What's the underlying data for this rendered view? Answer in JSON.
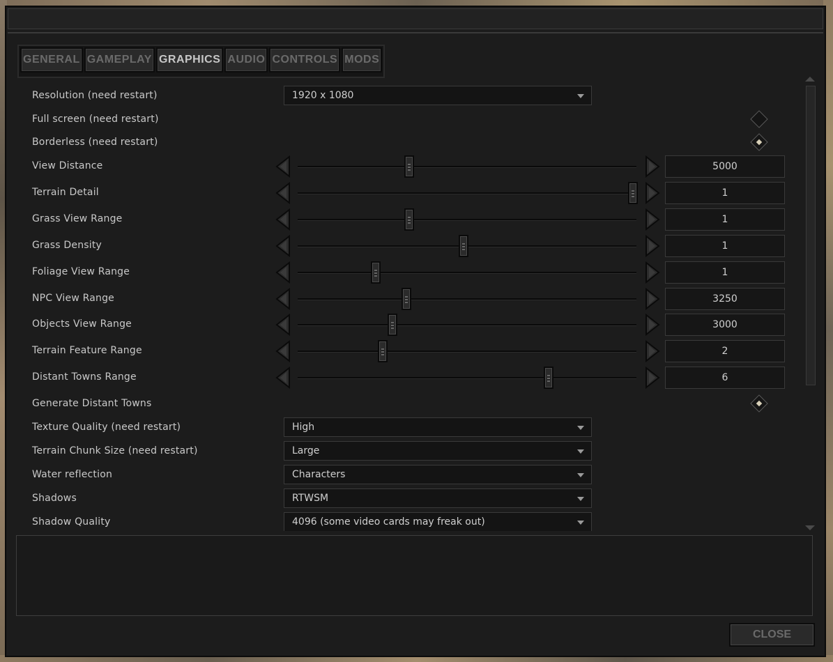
{
  "tabs": [
    {
      "label": "GENERAL",
      "active": false
    },
    {
      "label": "GAMEPLAY",
      "active": false
    },
    {
      "label": "GRAPHICS",
      "active": true
    },
    {
      "label": "AUDIO",
      "active": false
    },
    {
      "label": "CONTROLS",
      "active": false
    },
    {
      "label": "MODS",
      "active": false
    }
  ],
  "settings": {
    "resolution": {
      "label": "Resolution (need restart)",
      "value": "1920 x 1080"
    },
    "fullscreen": {
      "label": "Full screen (need restart)",
      "checked": false
    },
    "borderless": {
      "label": "Borderless (need restart)",
      "checked": true
    },
    "view_distance": {
      "label": "View Distance",
      "value": "5000",
      "level": 0.33
    },
    "terrain_detail": {
      "label": "Terrain Detail",
      "value": "1",
      "level": 0.99
    },
    "grass_view_range": {
      "label": "Grass View Range",
      "value": "1",
      "level": 0.33
    },
    "grass_density": {
      "label": "Grass Density",
      "value": "1",
      "level": 0.49
    },
    "foliage_view_range": {
      "label": "Foliage View Range",
      "value": "1",
      "level": 0.23
    },
    "npc_view_range": {
      "label": "NPC View Range",
      "value": "3250",
      "level": 0.32
    },
    "objects_view_range": {
      "label": "Objects View Range",
      "value": "3000",
      "level": 0.28
    },
    "terrain_feature_range": {
      "label": "Terrain Feature Range",
      "value": "2",
      "level": 0.25
    },
    "distant_towns_range": {
      "label": "Distant Towns Range",
      "value": "6",
      "level": 0.74
    },
    "generate_distant_towns": {
      "label": "Generate Distant Towns",
      "checked": true
    },
    "texture_quality": {
      "label": "Texture Quality (need restart)",
      "value": "High"
    },
    "terrain_chunk_size": {
      "label": "Terrain Chunk Size (need restart)",
      "value": "Large"
    },
    "water_reflection": {
      "label": "Water reflection",
      "value": "Characters"
    },
    "shadows": {
      "label": "Shadows",
      "value": "RTWSM"
    },
    "shadow_quality": {
      "label": "Shadow Quality",
      "value": "4096 (some video cards may freak out)"
    }
  },
  "footer": {
    "close_label": "CLOSE"
  },
  "colors": {
    "panel": "#1c1c1c",
    "text": "#c9c9c9",
    "tab_inactive": "#6a6a6a",
    "tab_active": "#c7c7c7"
  }
}
